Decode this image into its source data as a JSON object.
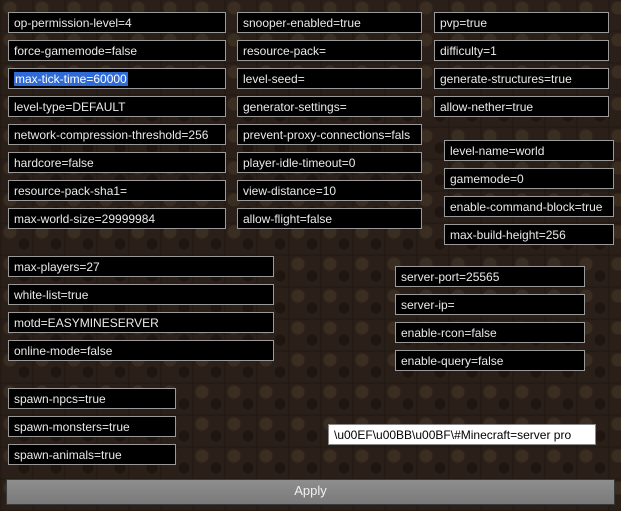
{
  "colA": [
    "op-permission-level=4",
    "force-gamemode=false",
    "max-tick-time=60000",
    "level-type=DEFAULT",
    "network-compression-threshold=256",
    "hardcore=false",
    "resource-pack-sha1=",
    "max-world-size=29999984"
  ],
  "colB": [
    "snooper-enabled=true",
    "resource-pack=",
    "level-seed=",
    "generator-settings=",
    "prevent-proxy-connections=fals",
    "player-idle-timeout=0",
    "view-distance=10",
    "allow-flight=false"
  ],
  "colC": [
    "pvp=true",
    "difficulty=1",
    "generate-structures=true",
    "allow-nether=true"
  ],
  "colD": [
    "level-name=world",
    "gamemode=0",
    "enable-command-block=true",
    "max-build-height=256"
  ],
  "groupE": [
    "max-players=27",
    "white-list=true",
    "motd=EASYMINESERVER",
    "online-mode=false"
  ],
  "groupF": [
    "server-port=25565",
    "server-ip=",
    "enable-rcon=false",
    "enable-query=false"
  ],
  "groupG": [
    "spawn-npcs=true",
    "spawn-monsters=true",
    "spawn-animals=true"
  ],
  "rawline": "\\u00EF\\u00BB\\u00BF\\#Minecraft=server pro",
  "apply_label": "Apply",
  "selected_index": 2
}
